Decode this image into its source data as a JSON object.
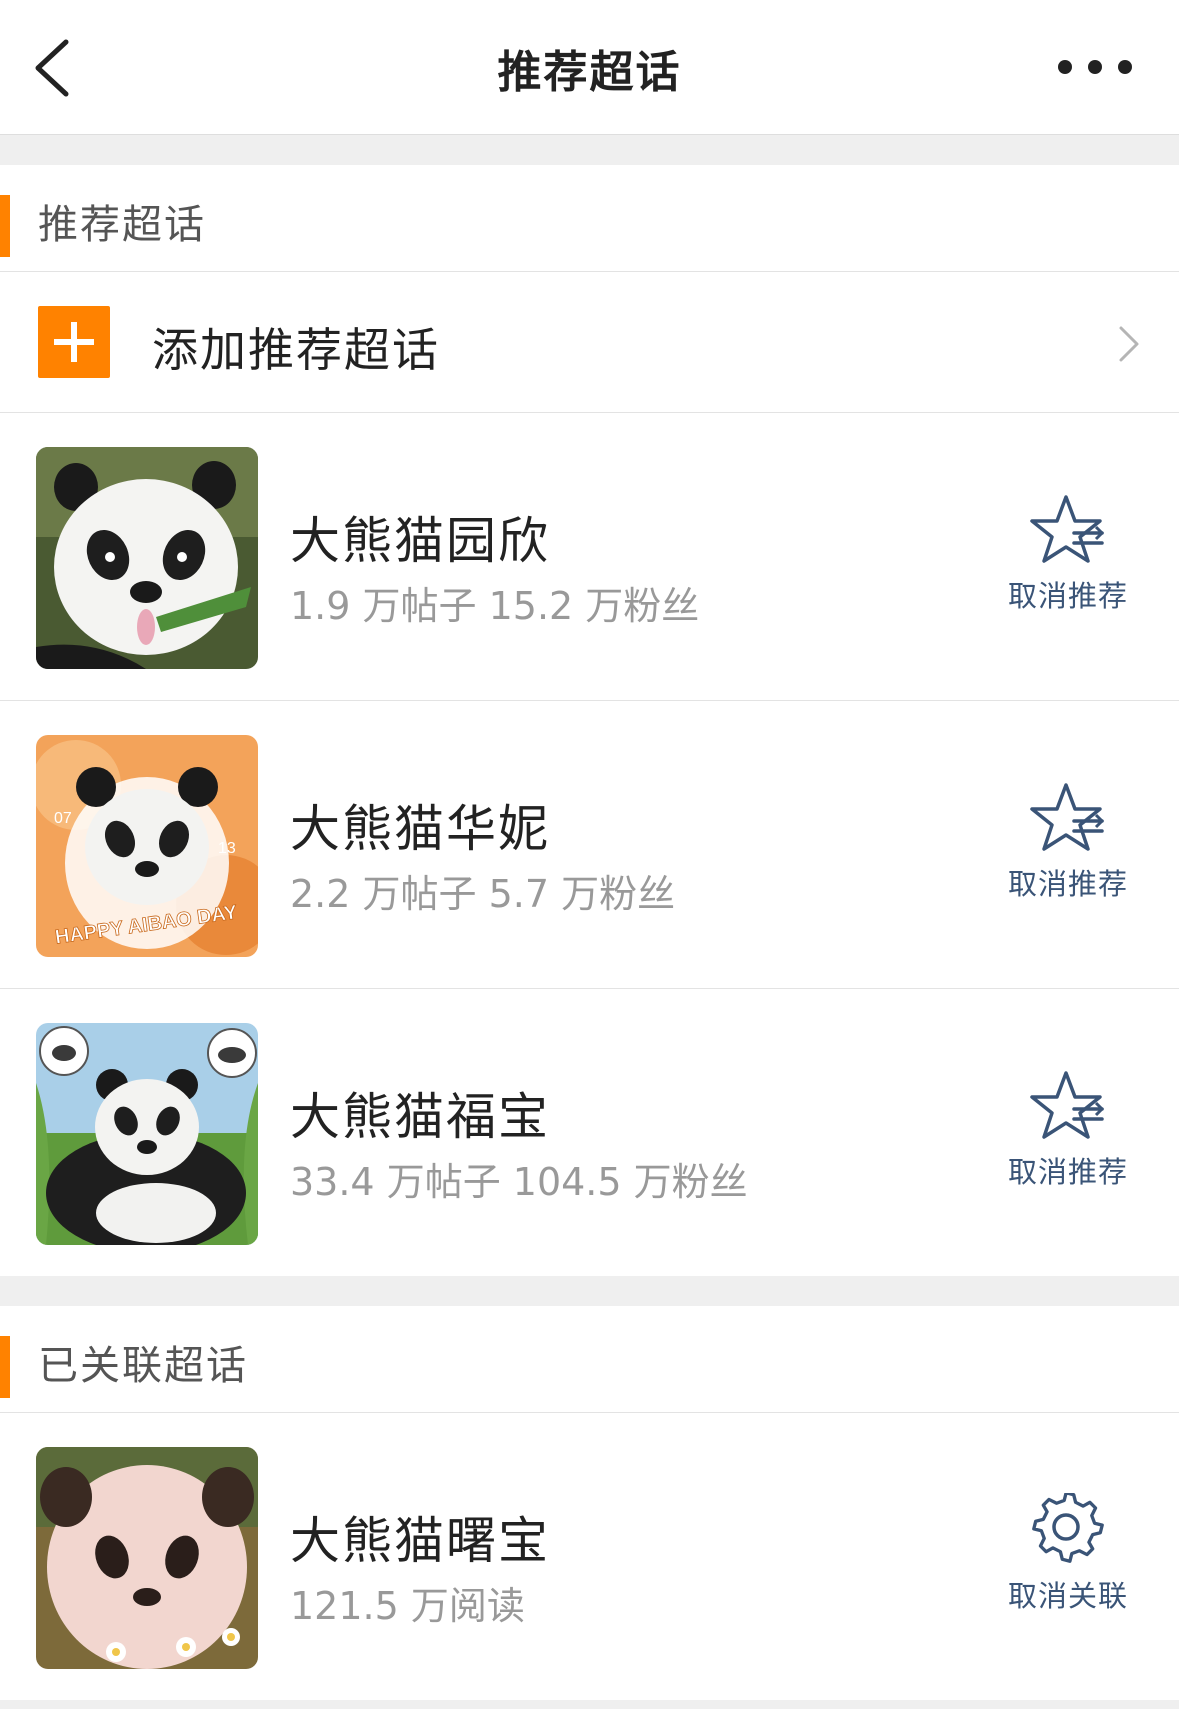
{
  "navbar": {
    "title": "推荐超话",
    "back_icon": "back-chevron-icon",
    "more_icon": "more-dots-icon"
  },
  "recommended": {
    "section_title": "推荐超话",
    "add": {
      "label": "添加推荐超话",
      "icon": "plus-icon"
    },
    "items": [
      {
        "name": "大熊猫园欣",
        "stats": "1.9 万帖子 15.2 万粉丝",
        "action": "取消推荐",
        "action_icon": "star-remove-icon"
      },
      {
        "name": "大熊猫华妮",
        "stats": "2.2 万帖子 5.7 万粉丝",
        "action": "取消推荐",
        "action_icon": "star-remove-icon",
        "avatar_text": {
          "banner": "HAPPY AIBAO DAY",
          "left": "07",
          "right": "13"
        }
      },
      {
        "name": "大熊猫福宝",
        "stats": "33.4 万帖子 104.5 万粉丝",
        "action": "取消推荐",
        "action_icon": "star-remove-icon"
      }
    ]
  },
  "linked": {
    "section_title": "已关联超话",
    "items": [
      {
        "name": "大熊猫曙宝",
        "stats": "121.5 万阅读",
        "action": "取消关联",
        "action_icon": "gear-icon"
      }
    ]
  },
  "colors": {
    "accent": "#ff8200",
    "action_text": "#3a5477",
    "secondary_text": "#999999"
  }
}
